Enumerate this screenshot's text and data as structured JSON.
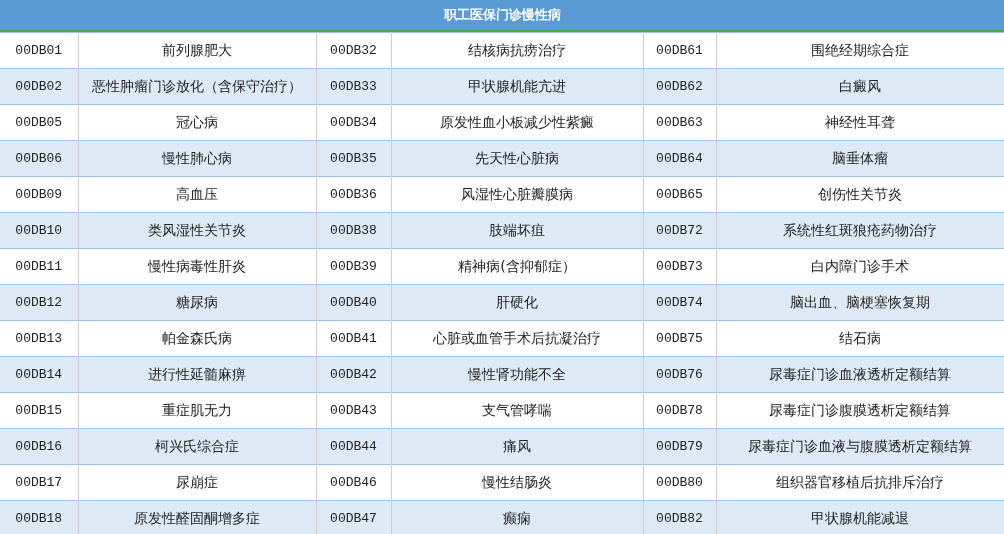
{
  "table": {
    "title": "职工医保门诊慢性病",
    "rows": [
      {
        "cells": [
          "00DB01",
          "前列腺肥大",
          "00DB32",
          "结核病抗痨治疗",
          "00DB61",
          "围绝经期综合症"
        ]
      },
      {
        "cells": [
          "00DB02",
          "恶性肿瘤门诊放化（含保守治疗）",
          "00DB33",
          "甲状腺机能亢进",
          "00DB62",
          "白癜风"
        ]
      },
      {
        "cells": [
          "00DB05",
          "冠心病",
          "00DB34",
          "原发性血小板减少性紫癜",
          "00DB63",
          "神经性耳聋"
        ]
      },
      {
        "cells": [
          "00DB06",
          "慢性肺心病",
          "00DB35",
          "先天性心脏病",
          "00DB64",
          "脑垂体瘤"
        ]
      },
      {
        "cells": [
          "00DB09",
          "高血压",
          "00DB36",
          "风湿性心脏瓣膜病",
          "00DB65",
          "创伤性关节炎"
        ]
      },
      {
        "cells": [
          "00DB10",
          "类风湿性关节炎",
          "00DB38",
          "肢端坏疽",
          "00DB72",
          "系统性红斑狼疮药物治疗"
        ]
      },
      {
        "cells": [
          "00DB11",
          "慢性病毒性肝炎",
          "00DB39",
          "精神病(含抑郁症）",
          "00DB73",
          "白内障门诊手术"
        ]
      },
      {
        "cells": [
          "00DB12",
          "糖尿病",
          "00DB40",
          "肝硬化",
          "00DB74",
          "脑出血、脑梗塞恢复期"
        ]
      },
      {
        "cells": [
          "00DB13",
          "帕金森氏病",
          "00DB41",
          "心脏或血管手术后抗凝治疗",
          "00DB75",
          "结石病"
        ]
      },
      {
        "cells": [
          "00DB14",
          "进行性延髓麻痹",
          "00DB42",
          "慢性肾功能不全",
          "00DB76",
          "尿毒症门诊血液透析定额结算"
        ]
      },
      {
        "cells": [
          "00DB15",
          "重症肌无力",
          "00DB43",
          "支气管哮喘",
          "00DB78",
          "尿毒症门诊腹膜透析定额结算"
        ]
      },
      {
        "cells": [
          "00DB16",
          "柯兴氏综合症",
          "00DB44",
          "痛风",
          "00DB79",
          "尿毒症门诊血液与腹膜透析定额结算"
        ]
      },
      {
        "cells": [
          "00DB17",
          "尿崩症",
          "00DB46",
          "慢性结肠炎",
          "00DB80",
          "组织器官移植后抗排斥治疗"
        ]
      },
      {
        "cells": [
          "00DB18",
          "原发性醛固酮增多症",
          "00DB47",
          "癫痫",
          "00DB82",
          "甲状腺机能减退"
        ]
      }
    ]
  }
}
